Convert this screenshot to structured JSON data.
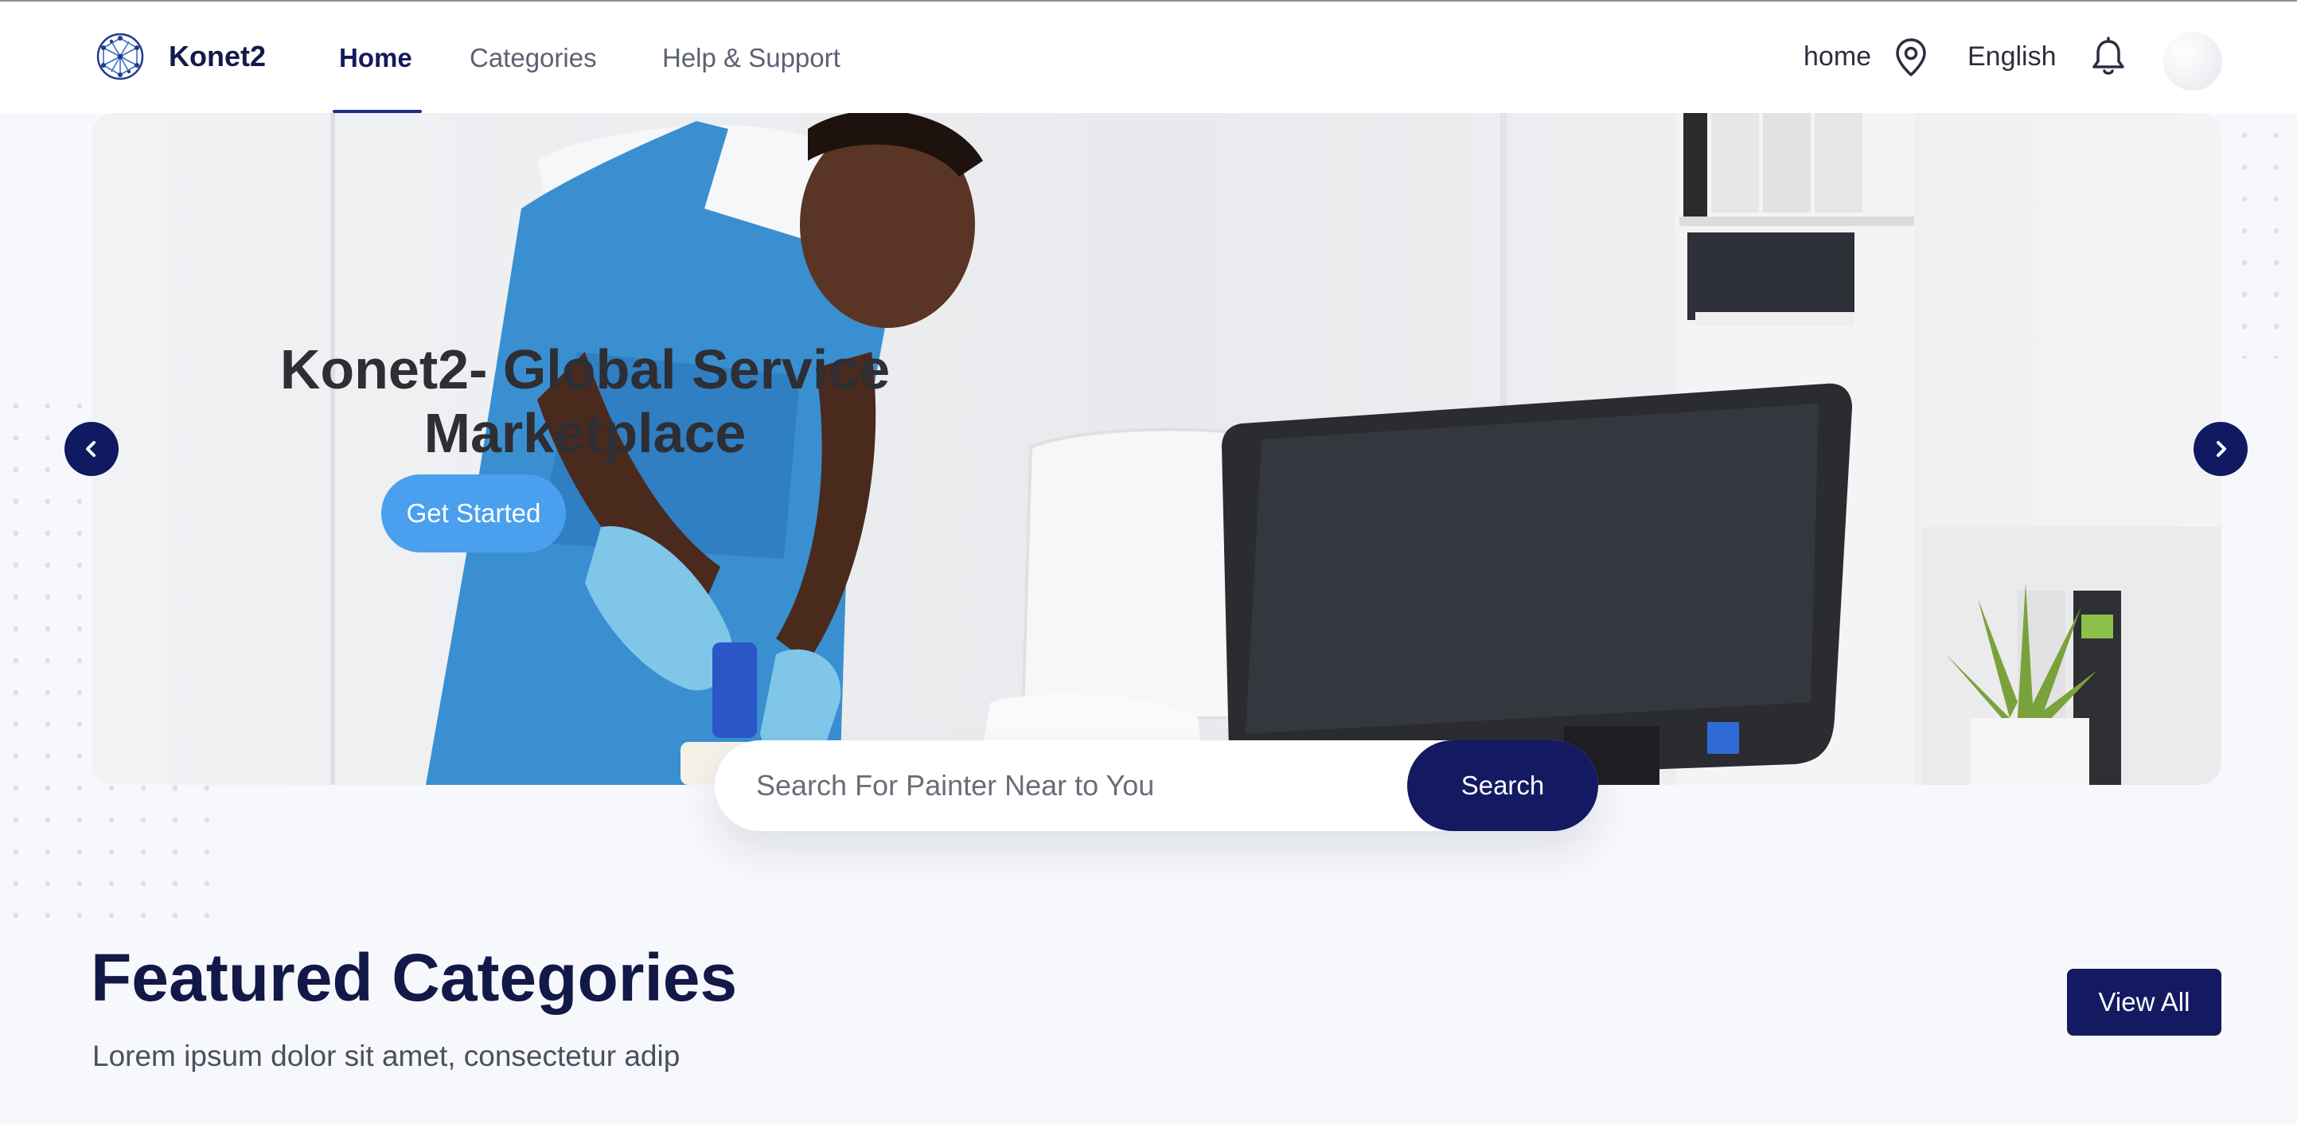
{
  "brand": {
    "name": "Konet2",
    "logo_icon": "globe-network-icon"
  },
  "nav": {
    "items": [
      {
        "label": "Home",
        "active": true
      },
      {
        "label": "Categories",
        "active": false
      },
      {
        "label": "Help & Support",
        "active": false
      }
    ]
  },
  "header_right": {
    "location_label": "home",
    "location_icon": "map-pin-icon",
    "language": "English",
    "notification_icon": "bell-icon",
    "avatar_icon": "avatar"
  },
  "hero": {
    "title": "Konet2- Global Service Marketplace",
    "cta_label": "Get Started",
    "prev_icon": "chevron-left-icon",
    "next_icon": "chevron-right-icon"
  },
  "search": {
    "placeholder": "Search For Painter Near to You",
    "value": "",
    "button_label": "Search"
  },
  "featured": {
    "title": "Featured Categories",
    "subtitle": "Lorem ipsum dolor sit amet, consectetur adip",
    "view_all_label": "View All"
  },
  "colors": {
    "primary_navy": "#141a62",
    "cta_blue": "#4aa0ef",
    "background": "#f7f8fb"
  }
}
